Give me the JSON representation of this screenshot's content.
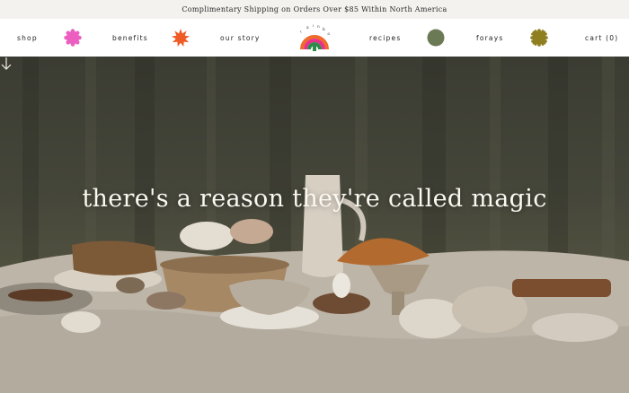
{
  "announcement": "Complimentary Shipping on Orders Over $85 Within North America",
  "nav": {
    "shop": "shop",
    "benefits": "benefits",
    "our_story": "our story",
    "recipes": "recipes",
    "forays": "forays",
    "cart": "cart (0)"
  },
  "logo": {
    "arc_text": "rainbo",
    "colors": [
      "#f06a2a",
      "#e8308a",
      "#2e8a4a"
    ]
  },
  "icons": {
    "shop_flower": {
      "name": "pink-flower-icon",
      "color": "#ec5fc1"
    },
    "benefits_burst": {
      "name": "orange-burst-icon",
      "color": "#ef5a25"
    },
    "recipes_dot": {
      "name": "green-circle-icon",
      "color": "#6b7a55"
    },
    "forays_seal": {
      "name": "olive-seal-icon",
      "color": "#8f7f20"
    }
  },
  "hero": {
    "heading": "there's a reason they're called magic",
    "scroll_icon": "arrow-down-icon"
  }
}
